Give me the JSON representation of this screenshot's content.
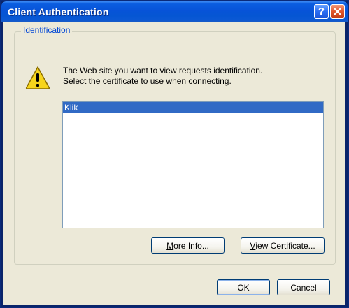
{
  "dialog": {
    "title": "Client Authentication",
    "help_glyph": "?",
    "close_glyph": "✕"
  },
  "group": {
    "label": "Identification"
  },
  "message": {
    "line1": "The Web site you want to view requests identification.",
    "line2": "Select the certificate to use when connecting."
  },
  "certificates": {
    "items": [
      {
        "label": "Klik",
        "selected": true
      }
    ]
  },
  "buttons": {
    "more_info": {
      "accel": "M",
      "rest": "ore Info..."
    },
    "view_certificate": {
      "accel": "V",
      "rest": "iew Certificate..."
    },
    "ok": {
      "label": "OK"
    },
    "cancel": {
      "label": "Cancel"
    }
  },
  "icons": {
    "warning": "warning-icon",
    "help": "help-icon",
    "close": "close-icon"
  },
  "colors": {
    "titlebar": "#0753d8",
    "selection": "#316ac5",
    "group_label": "#0046d5",
    "dialog_bg": "#ece9d8",
    "close_button": "#e0542a"
  }
}
